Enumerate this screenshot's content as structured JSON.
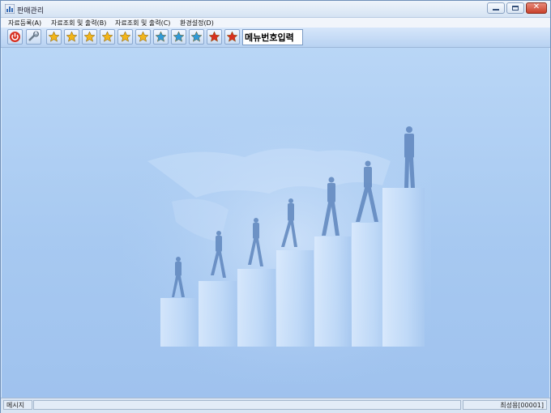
{
  "window": {
    "title": "판매관리"
  },
  "menu": [
    {
      "label": "자료등록(A)"
    },
    {
      "label": "자료조회 및 출력(B)"
    },
    {
      "label": "자료조회 및 출력(C)"
    },
    {
      "label": "환경설정(D)"
    }
  ],
  "toolbar": {
    "buttons": [
      {
        "icon": "power-icon",
        "color": "#d83020"
      },
      {
        "icon": "tools-icon",
        "color": "#7a8a9a"
      },
      {
        "icon": "star-icon",
        "color": "#f2b51a"
      },
      {
        "icon": "star-icon",
        "color": "#f2b51a"
      },
      {
        "icon": "star-icon",
        "color": "#f2b51a"
      },
      {
        "icon": "star-icon",
        "color": "#f2b51a"
      },
      {
        "icon": "star-icon",
        "color": "#f2b51a"
      },
      {
        "icon": "star-icon",
        "color": "#f2b51a"
      },
      {
        "icon": "star-icon",
        "color": "#2f9ad8"
      },
      {
        "icon": "star-icon",
        "color": "#2f9ad8"
      },
      {
        "icon": "star-icon",
        "color": "#2f9ad8"
      },
      {
        "icon": "star-icon",
        "color": "#d83020"
      },
      {
        "icon": "star-icon",
        "color": "#d83020"
      }
    ],
    "menu_number_input": "메뉴번호입력"
  },
  "status": {
    "message_label": "메시지",
    "message_text": "",
    "user": "최성용[00001]"
  },
  "colors": {
    "workspace": "#a9cbf2",
    "accent": "#3c6fb4"
  }
}
